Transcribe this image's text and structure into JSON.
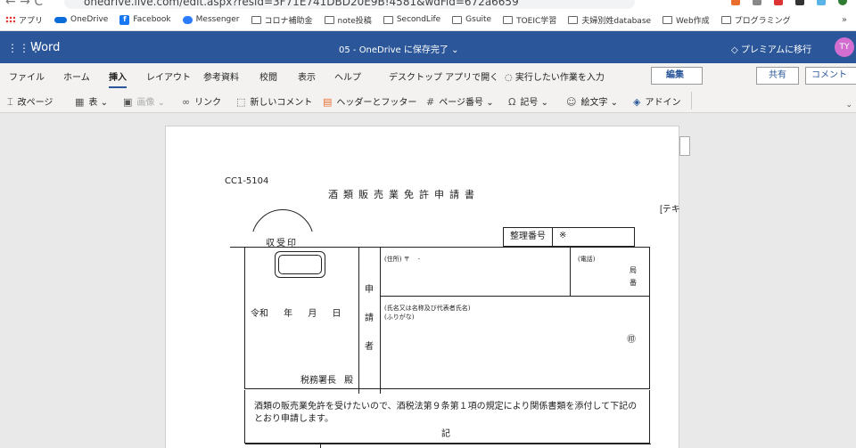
{
  "browser": {
    "url": "onedrive.live.com/edit.aspx?resid=3F71E741DBD20E9B!4581&wdFid=672a6659",
    "bookmarks": [
      {
        "label": "アプリ",
        "icon": "apps-grid-icon"
      },
      {
        "label": "OneDrive",
        "icon": "cloud-icon"
      },
      {
        "label": "Facebook",
        "icon": "facebook-icon"
      },
      {
        "label": "Messenger",
        "icon": "messenger-icon"
      },
      {
        "label": "コロナ補助金",
        "icon": "folder-icon"
      },
      {
        "label": "note投稿",
        "icon": "folder-icon"
      },
      {
        "label": "SecondLife",
        "icon": "folder-icon"
      },
      {
        "label": "Gsuite",
        "icon": "folder-icon"
      },
      {
        "label": "TOEIC学習",
        "icon": "folder-icon"
      },
      {
        "label": "夫婦別姓database",
        "icon": "folder-icon"
      },
      {
        "label": "Web作成",
        "icon": "folder-icon"
      },
      {
        "label": "プログラミング",
        "icon": "folder-icon"
      }
    ],
    "more": "»"
  },
  "appbar": {
    "app_name": "Word",
    "doc_status": "05 - OneDrive に保存完了 ⌄",
    "premium": "プレミアムに移行",
    "avatar": "TY",
    "brand_color": "#2b579a"
  },
  "tabs": [
    "ファイル",
    "ホーム",
    "挿入",
    "レイアウト",
    "参考資料",
    "校閲",
    "表示",
    "ヘルプ",
    "デスクトップ アプリで開く",
    "実行したい作業を入力"
  ],
  "active_tab": "挿入",
  "edit_label": "編集",
  "share_label": "共有",
  "comment_label": "コメント",
  "toolbar": [
    {
      "label": "改ページ",
      "icon": "page-break-icon"
    },
    {
      "label": "表",
      "icon": "table-icon"
    },
    {
      "label": "画像",
      "icon": "picture-icon"
    },
    {
      "label": "リンク",
      "icon": "link-icon"
    },
    {
      "label": "新しいコメント",
      "icon": "comment-icon"
    },
    {
      "label": "ヘッダーとフッター",
      "icon": "header-footer-icon"
    },
    {
      "label": "ページ番号",
      "icon": "page-number-icon"
    },
    {
      "label": "記号",
      "icon": "omega-icon"
    },
    {
      "label": "絵文字",
      "icon": "emoji-icon"
    },
    {
      "label": "アドイン",
      "icon": "addin-icon"
    }
  ],
  "document": {
    "code": "CC1-5104",
    "title": "酒類販売業免許申請書",
    "seal_label": "収受印",
    "ref_label": "整理番号",
    "ref_mark": "※",
    "date": "令和 年 月 日",
    "office": "税務署長 殿",
    "applicant": "申請者",
    "address_label": "(住所) 〒    -",
    "phone_label": "(電話)",
    "phone_a": "局",
    "phone_b": "番",
    "name_label_1": "(氏名又は名称及び代表者氏名)",
    "name_label_2": "(ふりがな)",
    "seal_mark": "㊞",
    "body_text": "酒類の販売業免許を受けたいので、酒税法第９条第１項の規定により関係書類を添付して下記のとおり申請します。",
    "ki": "記",
    "side_tag": "[テキ"
  }
}
